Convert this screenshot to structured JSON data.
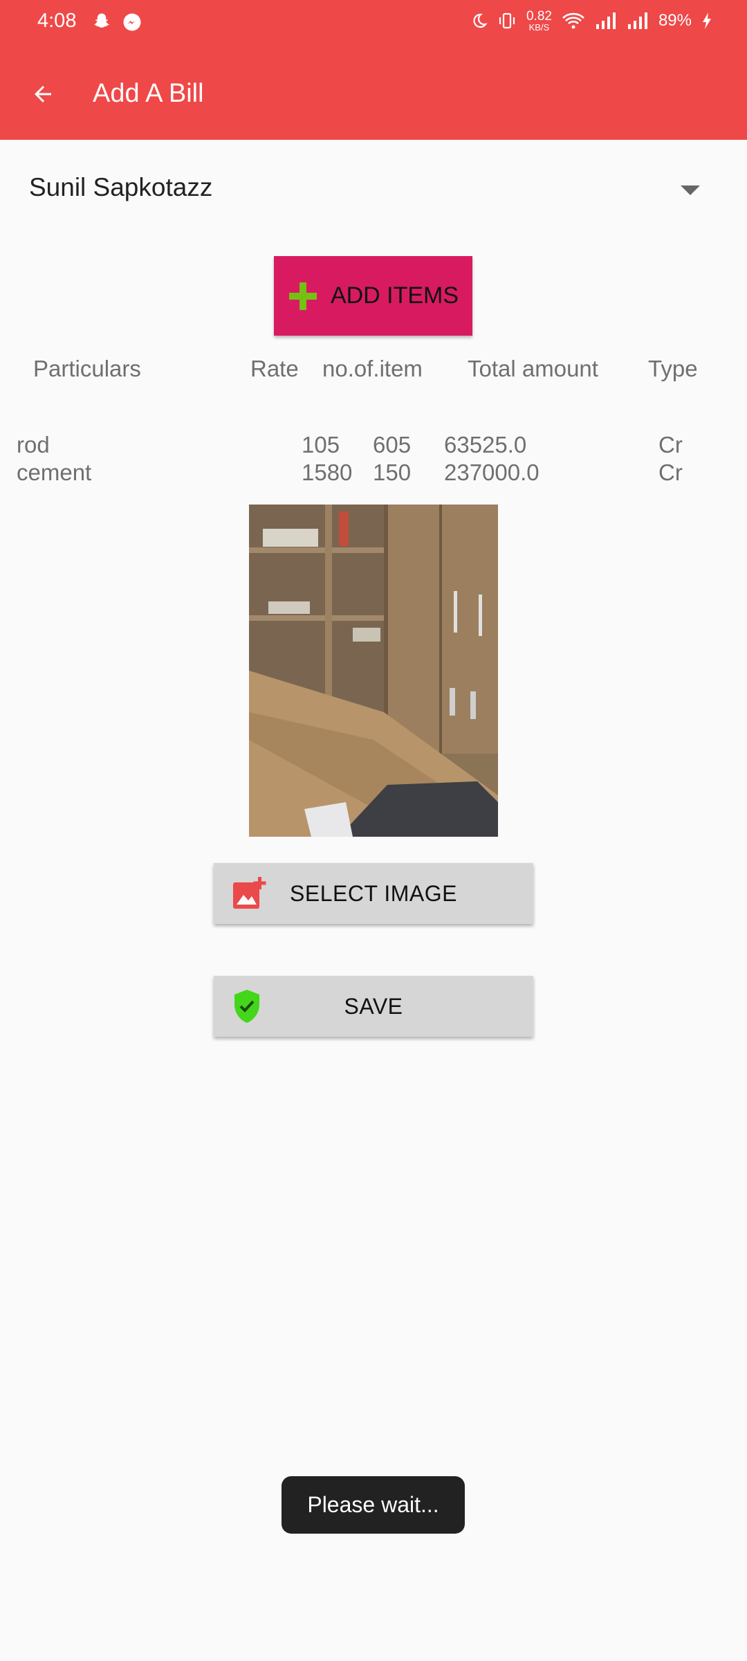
{
  "status_bar": {
    "time": "4:08",
    "speed_value": "0.82",
    "speed_unit": "KB/S",
    "battery": "89%"
  },
  "app_bar": {
    "title": "Add A Bill",
    "back_icon": "arrow-back-icon"
  },
  "account_selector": {
    "selected": "Sunil Sapkotazz"
  },
  "add_items_button": {
    "label": "ADD ITEMS",
    "icon": "plus-icon",
    "color": "#d81b60",
    "icon_color": "#76c013"
  },
  "table": {
    "headers": [
      "Particulars",
      "Rate",
      "no.of.item",
      "Total amount",
      "Type"
    ],
    "rows": [
      {
        "particular": "rod",
        "rate": "105",
        "qty": "605",
        "total": "63525.0",
        "type": "Cr"
      },
      {
        "particular": "cement",
        "rate": "1580",
        "qty": "150",
        "total": "237000.0",
        "type": "Cr"
      }
    ]
  },
  "select_image_button": {
    "label": "SELECT IMAGE",
    "icon": "add-photo-icon",
    "icon_color": "#ea4a4a"
  },
  "save_button": {
    "label": "SAVE",
    "icon": "verified-shield-icon",
    "icon_color": "#43d61b"
  },
  "toast": {
    "message": "Please wait..."
  },
  "colors": {
    "primary": "#ef4848",
    "background": "#fafafa",
    "button_gray": "#d6d6d6"
  }
}
